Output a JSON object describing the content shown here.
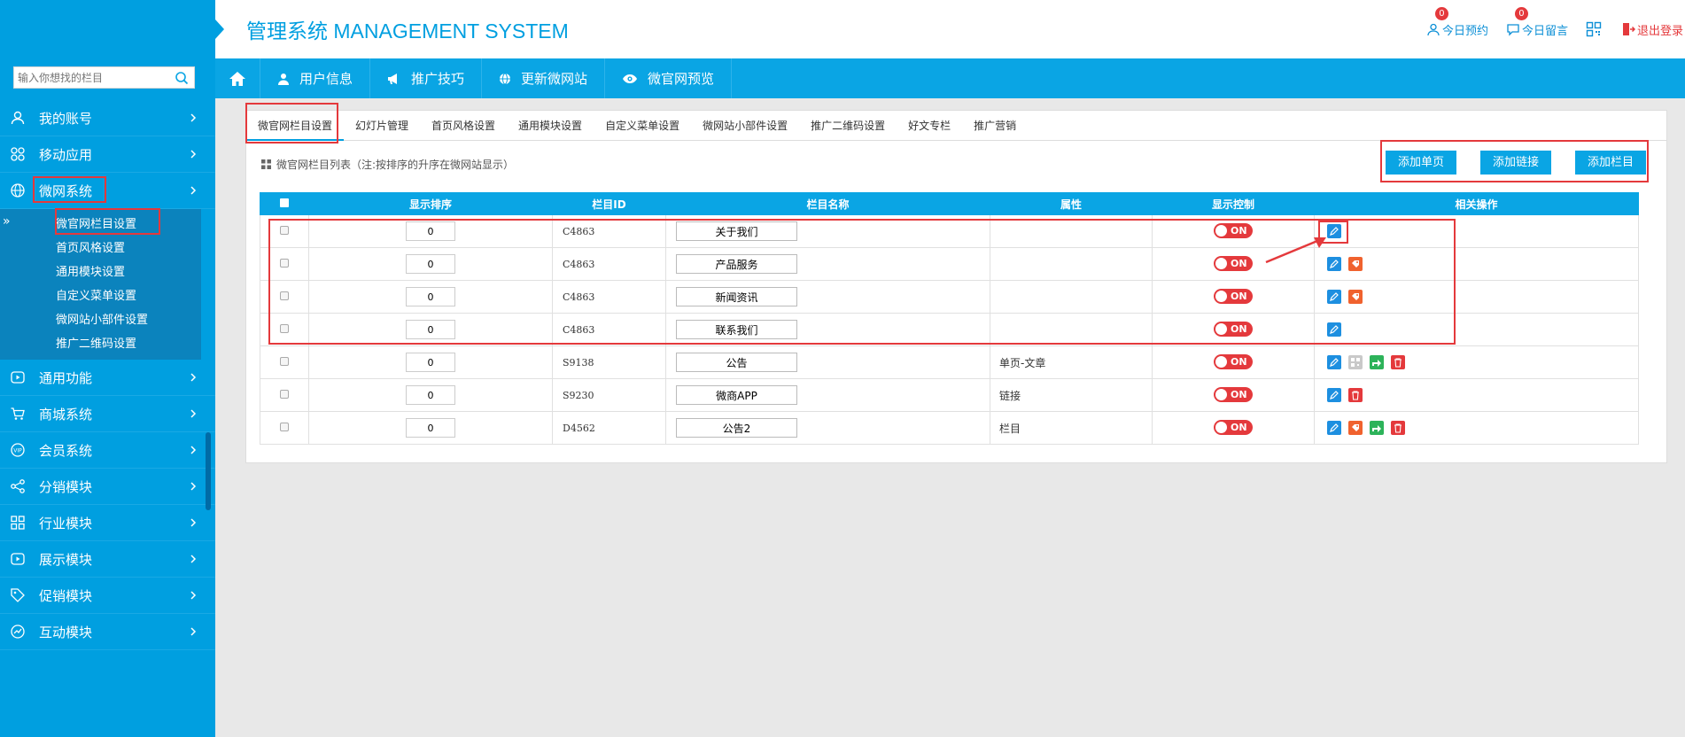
{
  "header": {
    "title": "管理系统 MANAGEMENT SYSTEM",
    "links": [
      {
        "label": "今日预约",
        "badge": "0",
        "icon": "user-icon"
      },
      {
        "label": "今日留言",
        "badge": "0",
        "icon": "message-icon"
      },
      {
        "label": "",
        "icon": "qrcode-icon"
      },
      {
        "label": "退出登录",
        "icon": "logout-icon"
      }
    ]
  },
  "sidebar": {
    "search_placeholder": "输入你想找的栏目",
    "menu": [
      {
        "label": "我的账号",
        "icon": "user-icon"
      },
      {
        "label": "移动应用",
        "icon": "grid-icon"
      },
      {
        "label": "微网系统",
        "icon": "globe-icon"
      },
      {
        "label": "通用功能",
        "icon": "play-icon"
      },
      {
        "label": "商城系统",
        "icon": "cart-icon"
      },
      {
        "label": "会员系统",
        "icon": "vip-icon"
      },
      {
        "label": "分销模块",
        "icon": "share-icon"
      },
      {
        "label": "行业模块",
        "icon": "modules-icon"
      },
      {
        "label": "展示模块",
        "icon": "display-icon"
      },
      {
        "label": "促销模块",
        "icon": "tag-icon"
      },
      {
        "label": "互动模块",
        "icon": "interaction-icon"
      }
    ],
    "submenu": [
      "微官网栏目设置",
      "首页风格设置",
      "通用模块设置",
      "自定义菜单设置",
      "微网站小部件设置",
      "推广二维码设置"
    ]
  },
  "topnav": {
    "items": [
      {
        "label": "用户信息",
        "icon": "user-icon"
      },
      {
        "label": "推广技巧",
        "icon": "megaphone-icon"
      },
      {
        "label": "更新微网站",
        "icon": "globe-icon"
      },
      {
        "label": "微官网预览",
        "icon": "eye-icon"
      }
    ]
  },
  "tabs": [
    "微官网栏目设置",
    "幻灯片管理",
    "首页风格设置",
    "通用模块设置",
    "自定义菜单设置",
    "微网站小部件设置",
    "推广二维码设置",
    "好文专栏",
    "推广营销"
  ],
  "list": {
    "title": "微官网栏目列表（注:按排序的升序在微网站显示）",
    "buttons": [
      "添加单页",
      "添加链接",
      "添加栏目"
    ],
    "columns": [
      "",
      "显示排序",
      "栏目ID",
      "栏目名称",
      "属性",
      "显示控制",
      "相关操作"
    ],
    "rows": [
      {
        "sort": "0",
        "id": "C4863",
        "name": "关于我们",
        "attr": "",
        "toggle": "ON",
        "ops": [
          "edit"
        ]
      },
      {
        "sort": "0",
        "id": "C4863",
        "name": "产品服务",
        "attr": "",
        "toggle": "ON",
        "ops": [
          "edit",
          "tag"
        ]
      },
      {
        "sort": "0",
        "id": "C4863",
        "name": "新闻资讯",
        "attr": "",
        "toggle": "ON",
        "ops": [
          "edit",
          "tag"
        ]
      },
      {
        "sort": "0",
        "id": "C4863",
        "name": "联系我们",
        "attr": "",
        "toggle": "ON",
        "ops": [
          "edit"
        ]
      },
      {
        "sort": "0",
        "id": "S9138",
        "name": "公告",
        "attr": "单页-文章",
        "toggle": "ON",
        "ops": [
          "edit",
          "qrcode",
          "share",
          "delete"
        ]
      },
      {
        "sort": "0",
        "id": "S9230",
        "name": "微商APP",
        "attr": "链接",
        "toggle": "ON",
        "ops": [
          "edit",
          "delete"
        ]
      },
      {
        "sort": "0",
        "id": "D4562",
        "name": "公告2",
        "attr": "栏目",
        "toggle": "ON",
        "ops": [
          "edit",
          "tag",
          "share",
          "delete"
        ]
      }
    ]
  },
  "colors": {
    "primary": "#009fe0",
    "danger": "#e4393c",
    "edit": "#1d8fe0",
    "tag": "#f0622e",
    "share": "#2db35a"
  }
}
